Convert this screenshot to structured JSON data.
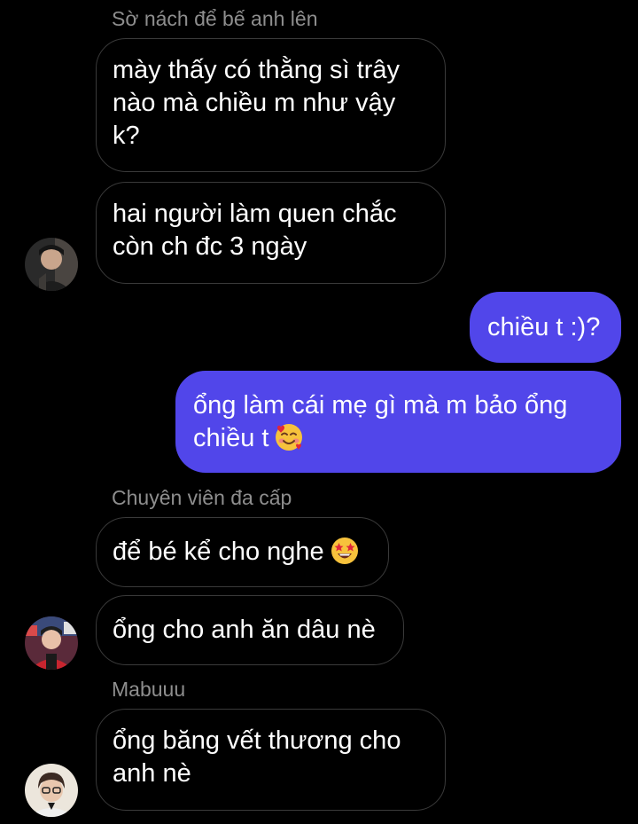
{
  "groups": [
    {
      "sender": "Sờ nách để bế anh lên",
      "messages": [
        {
          "lines": [
            "mày thấy có thằng sì trây",
            "nào mà chiều m như vậy",
            "k?"
          ]
        },
        {
          "lines": [
            "hai người làm quen chắc",
            "còn ch đc 3 ngày"
          ]
        }
      ]
    },
    {
      "sender": "Chuyên viên đa cấp",
      "messages": [
        {
          "lines": [
            "để bé kể cho nghe"
          ],
          "emoji": "star-struck-emoji"
        },
        {
          "lines": [
            "ổng cho anh ăn dâu nè"
          ]
        }
      ]
    },
    {
      "sender": "Mabuuu",
      "messages": [
        {
          "lines": [
            "ổng băng vết thương cho",
            "anh nè"
          ]
        }
      ]
    }
  ],
  "outgoing": [
    {
      "lines": [
        "chiều t :)?"
      ]
    },
    {
      "lines": [
        "ổng làm cái mẹ gì mà m bảo ổng",
        "chiều t"
      ],
      "emoji": "smiling-face-with-hearts-emoji"
    }
  ],
  "colors": {
    "outgoing_bubble": "#5146ea",
    "incoming_border": "#3a3a3a",
    "sender_name": "#8e8e8e",
    "background": "#000000"
  }
}
